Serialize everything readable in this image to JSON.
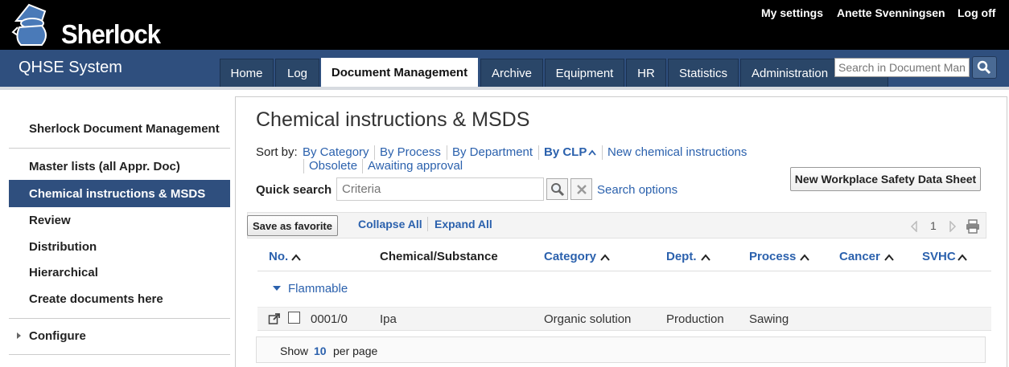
{
  "app": {
    "logo_text": "Sherlock",
    "title": "QHSE System"
  },
  "top_links": {
    "settings": "My settings",
    "user": "Anette Svenningsen",
    "logoff": "Log off"
  },
  "nav": {
    "tabs": [
      "Home",
      "Log",
      "Document Management",
      "Archive",
      "Equipment",
      "HR",
      "Statistics",
      "Administration"
    ],
    "active_tab": "Document Management",
    "search_placeholder": "Search in Document Management"
  },
  "sidebar": {
    "title": "Sherlock Document Management",
    "items": [
      "Master lists (all Appr. Doc)",
      "Chemical instructions & MSDS",
      "Review",
      "Distribution",
      "Hierarchical",
      "Create documents here"
    ],
    "active_item": "Chemical instructions & MSDS",
    "configure": "Configure"
  },
  "main": {
    "title": "Chemical instructions & MSDS",
    "sort_label": "Sort by:",
    "sort_links": [
      "By Category",
      "By Process",
      "By Department",
      "By CLP",
      "New chemical instructions",
      "Obsolete",
      "Awaiting approval"
    ],
    "active_sort": "By CLP",
    "new_sds_button": "New Workplace Safety Data Sheet",
    "quick_search_label": "Quick search",
    "quick_search_placeholder": "Criteria",
    "search_options": "Search options",
    "save_favorite": "Save as favorite",
    "collapse_all": "Collapse All",
    "expand_all": "Expand All",
    "page_number": "1"
  },
  "table": {
    "headers": [
      "No.",
      "Chemical/Substance",
      "Category",
      "Dept.",
      "Process",
      "Cancer",
      "SVHC"
    ],
    "group": "Flammable",
    "rows": [
      {
        "no": "0001/0",
        "chemical": "Ipa",
        "category": "Organic solution",
        "dept": "Production",
        "process": "Sawing",
        "cancer": "",
        "svhc": ""
      }
    ]
  },
  "pager": {
    "show": "Show",
    "count": "10",
    "per_page": "per page"
  },
  "colors": {
    "topbar": "#000000",
    "navbar": "#2f4f7e",
    "active_side": "#2f4f7e",
    "link": "#2b61ad"
  }
}
